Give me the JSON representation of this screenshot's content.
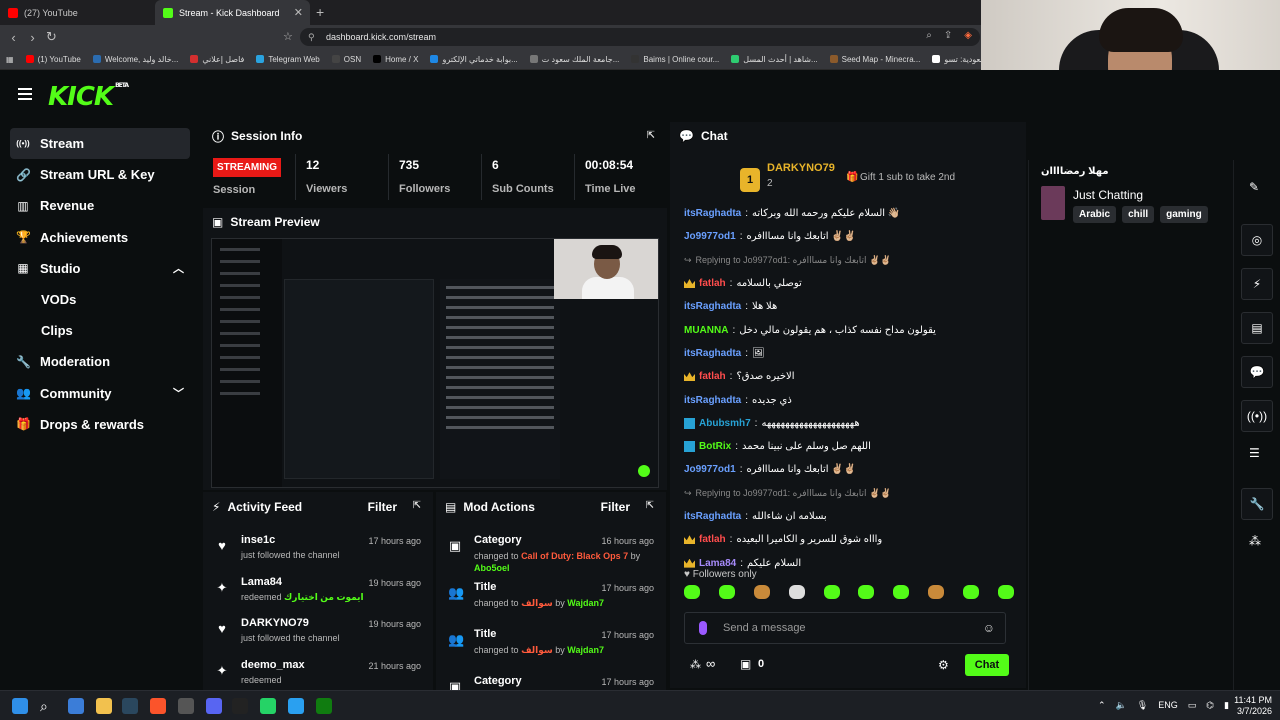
{
  "browser": {
    "tabs": [
      {
        "label": "(27) YouTube",
        "color": "#ff0000"
      },
      {
        "label": "Stream - Kick Dashboard",
        "color": "#53fc18"
      }
    ],
    "url": "dashboard.kick.com/stream",
    "bookmarks": [
      {
        "label": "(1) YouTube",
        "color": "#ff0000"
      },
      {
        "label": "Welcome, خالد وليد...",
        "color": "#2b6cb0"
      },
      {
        "label": "فاصل إعلاني",
        "color": "#d32f2f"
      },
      {
        "label": "Telegram Web",
        "color": "#2aa3df"
      },
      {
        "label": "OSN",
        "color": "#444444"
      },
      {
        "label": "Home / X",
        "color": "#000000"
      },
      {
        "label": "بوابة خدماتي الإلكترو...",
        "color": "#1e88e5"
      },
      {
        "label": "جامعة الملك سعود ت...",
        "color": "#777777"
      },
      {
        "label": "Baims | Online cour...",
        "color": "#333333"
      },
      {
        "label": "شاهد | أحدث المسل...",
        "color": "#2ecc71"
      },
      {
        "label": "Seed Map - Minecra...",
        "color": "#8b5a2b"
      },
      {
        "label": "السعودية: تسو...",
        "color": "#ffffff"
      }
    ]
  },
  "brand": {
    "logo": "KICK",
    "beta": "BETA",
    "accent": "#53fc18"
  },
  "sidebar": {
    "items": [
      {
        "label": "Stream",
        "icon": "broadcast-icon",
        "glyph": "((•))",
        "active": true
      },
      {
        "label": "Stream URL & Key",
        "icon": "link-icon",
        "glyph": "🔗"
      },
      {
        "label": "Revenue",
        "icon": "chart-icon",
        "glyph": "▥"
      },
      {
        "label": "Achievements",
        "icon": "trophy-icon",
        "glyph": "🏆"
      },
      {
        "label": "Studio",
        "icon": "studio-icon",
        "glyph": "▦",
        "chevron": "^"
      },
      {
        "label": "VODs",
        "sub": true
      },
      {
        "label": "Clips",
        "sub": true
      },
      {
        "label": "Moderation",
        "icon": "wrench-icon",
        "glyph": "🔧"
      },
      {
        "label": "Community",
        "icon": "community-icon",
        "glyph": "👥",
        "chevron": "v"
      },
      {
        "label": "Drops & rewards",
        "icon": "gift-icon",
        "glyph": "🎁"
      }
    ]
  },
  "session": {
    "title": "Session Info",
    "badge": "STREAMING",
    "badge_sub": "Session",
    "stats": [
      {
        "value": "12",
        "label": "Viewers"
      },
      {
        "value": "735",
        "label": "Followers"
      },
      {
        "value": "6",
        "label": "Sub Counts"
      },
      {
        "value": "00:08:54",
        "label": "Time Live"
      }
    ]
  },
  "preview": {
    "title": "Stream Preview"
  },
  "activity": {
    "title": "Activity Feed",
    "filter": "Filter",
    "rows": [
      {
        "name": "inse1c",
        "text": "just followed the channel",
        "time": "17 hours ago",
        "icon": "heart-icon",
        "glyph": "♥"
      },
      {
        "name": "Lama84",
        "text": "redeemed",
        "highlight": "ايموت من اختيارك",
        "time": "19 hours ago",
        "icon": "reward-icon",
        "glyph": "✦"
      },
      {
        "name": "DARKYNO79",
        "text": "just followed the channel",
        "time": "19 hours ago",
        "icon": "heart-icon",
        "glyph": "♥"
      },
      {
        "name": "deemo_max",
        "text": "redeemed",
        "time": "21 hours ago",
        "icon": "reward-icon",
        "glyph": "✦"
      }
    ]
  },
  "mod": {
    "title": "Mod Actions",
    "filter": "Filter",
    "rows": [
      {
        "name": "Category",
        "pre": "changed to",
        "value": "Call of Duty: Black Ops 7",
        "by": "by",
        "user": "Abo5oel",
        "time": "16 hours ago"
      },
      {
        "name": "Title",
        "pre": "changed to",
        "value": "سوالف",
        "by": "by",
        "user": "Wajdan7",
        "time": "17 hours ago"
      },
      {
        "name": "Title",
        "pre": "changed to",
        "value": "سوالف",
        "by": "by",
        "user": "Wajdan7",
        "time": "17 hours ago"
      },
      {
        "name": "Category",
        "pre": "",
        "value": "",
        "by": "",
        "user": "",
        "time": "17 hours ago"
      }
    ]
  },
  "chat": {
    "title": "Chat",
    "top_user": "DARKYNO79",
    "top_rank": "1",
    "top_count": "2",
    "gift": "Gift 1 sub to take 2nd",
    "followers_only": "Followers only",
    "placeholder": "Send a message",
    "send_label": "Chat",
    "points": "0",
    "messages": [
      {
        "user": "itsRaghadta",
        "color": "#6aa0ff",
        "text": "السلام عليكم ورحمه الله وبركاته 👋🏼"
      },
      {
        "user": "Jo9977od1",
        "color": "#6aa0ff",
        "text": "اتابعك وانا مسااافره ✌🏼✌🏼"
      },
      {
        "reply": "Replying to Jo9977od1: اتابعك وانا مسااافره ✌🏼✌🏼"
      },
      {
        "user": "fatlah",
        "color": "#ff4d4d",
        "crown": true,
        "text": "توصلي بالسلامه"
      },
      {
        "user": "itsRaghadta",
        "color": "#6aa0ff",
        "text": "هلا هلا"
      },
      {
        "user": "MUANNA",
        "color": "#53fc18",
        "text": "يقولون مداح نفسه كذاب ، هم يقولون مالي دخل"
      },
      {
        "user": "itsRaghadta",
        "color": "#6aa0ff",
        "text": "🖼"
      },
      {
        "user": "fatlah",
        "color": "#ff4d4d",
        "crown": true,
        "text": "الاخيره صدق؟"
      },
      {
        "user": "itsRaghadta",
        "color": "#6aa0ff",
        "text": "ذي جديده"
      },
      {
        "user": "Abubsmh7",
        "color": "#27a2d5",
        "mod": true,
        "text": "ههههههههههههههههههههه"
      },
      {
        "user": "BotRix",
        "color": "#53fc18",
        "mod": true,
        "text": "اللهم صل وسلم على نبينا محمد"
      },
      {
        "user": "Jo9977od1",
        "color": "#6aa0ff",
        "text": "اتابعك وانا مسااافره ✌🏼✌🏼"
      },
      {
        "reply": "Replying to Jo9977od1: اتابعك وانا مسااافره ✌🏼✌🏼"
      },
      {
        "user": "itsRaghadta",
        "color": "#6aa0ff",
        "text": "بسلامه ان شاءالله"
      },
      {
        "user": "fatlah",
        "color": "#ff4d4d",
        "crown": true,
        "text": "واااه شوق للسرير و الكاميرا البعيده"
      },
      {
        "user": "Lama84",
        "color": "#a78bfa",
        "crown": true,
        "text": "السلام عليكم"
      }
    ]
  },
  "stream_card": {
    "streamer": "مهلا رمضاااان",
    "category": "Just Chatting",
    "tags": [
      "Arabic",
      "chill",
      "gaming"
    ]
  },
  "taskbar": {
    "lang": "ENG",
    "time": "11:41 PM",
    "date": "3/7/2026"
  }
}
